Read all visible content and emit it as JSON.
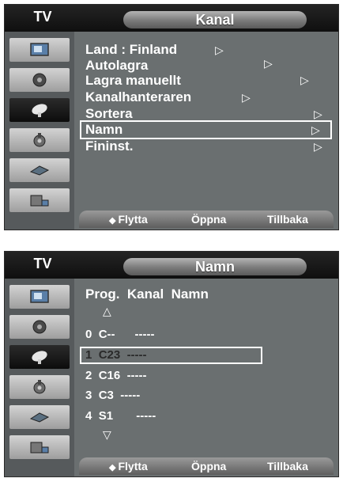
{
  "panel1": {
    "tv": "TV",
    "title": "Kanal",
    "items": [
      {
        "label": "Land  : Finland",
        "arrow": "▷"
      },
      {
        "label": "Autolagra",
        "arrow": "▷"
      },
      {
        "label": "Lagra manuellt",
        "arrow": "▷"
      },
      {
        "label": "Kanalhanteraren",
        "arrow": "▷"
      },
      {
        "label": "Sortera",
        "arrow": "▷"
      },
      {
        "label": "Namn",
        "arrow": "▷"
      },
      {
        "label": "Fininst.",
        "arrow": "▷"
      }
    ],
    "footer": {
      "move_icon": "◆",
      "move": "Flytta",
      "open": "Öppna",
      "back": "Tillbaka"
    }
  },
  "panel2": {
    "tv": "TV",
    "title": "Namn",
    "columns": "Prog.  Kanal  Namn",
    "up_arrow": "△",
    "down_arrow": "▽",
    "rows": [
      {
        "prog": "0",
        "kanal": "C--",
        "namn": "-----"
      },
      {
        "prog": "1",
        "kanal": "C23",
        "namn": "-----"
      },
      {
        "prog": "2",
        "kanal": "C16",
        "namn": "-----"
      },
      {
        "prog": "3",
        "kanal": "C3",
        "namn": "-----"
      },
      {
        "prog": "4",
        "kanal": "S1",
        "namn": "-----"
      }
    ],
    "selected_row": 1,
    "footer": {
      "move_icon": "◆",
      "move": "Flytta",
      "open": "Öppna",
      "back": "Tillbaka"
    }
  },
  "sidebar_icons": [
    "picture-icon",
    "sound-icon",
    "channel-icon",
    "setup-icon",
    "input-icon",
    "application-icon"
  ],
  "active_sidebar_index": 2,
  "colors": {
    "panel": "#6a6f70",
    "header": "#1a1a1a",
    "highlight": "#ffffff"
  }
}
